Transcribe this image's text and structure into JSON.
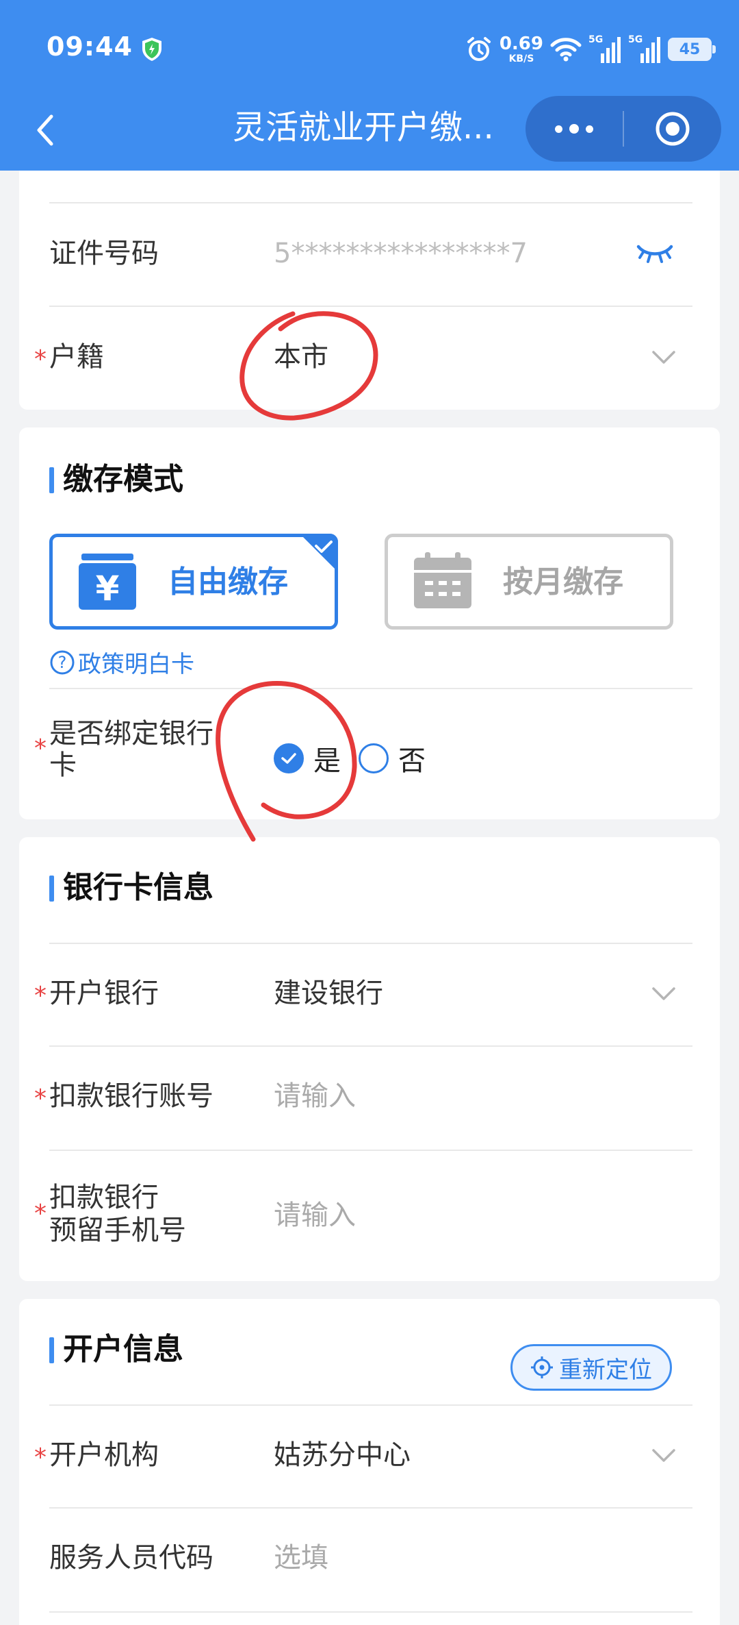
{
  "status_bar": {
    "time": "09:44",
    "net_speed_value": "0.69",
    "net_speed_unit": "KB/S",
    "signal1_tag": "5G",
    "signal2_tag": "5G",
    "battery": "45"
  },
  "nav": {
    "title": "灵活就业开户缴..."
  },
  "identity": {
    "id_label": "证件号码",
    "id_value": "5****************7",
    "household_label": "户籍",
    "household_value": "本市"
  },
  "deposit_mode": {
    "title": "缴存模式",
    "free_label": "自由缴存",
    "monthly_label": "按月缴存",
    "free_icon_glyph": "¥",
    "policy_link": "政策明白卡",
    "bind_label_line1": "是否绑定银行",
    "bind_label_line2": "卡",
    "yes_label": "是",
    "no_label": "否"
  },
  "bank_info": {
    "title": "银行卡信息",
    "bank_label": "开户银行",
    "bank_value": "建设银行",
    "account_label": "扣款银行账号",
    "account_placeholder": "请输入",
    "phone_label_line1": "扣款银行",
    "phone_label_line2": "预留手机号",
    "phone_placeholder": "请输入"
  },
  "account_info": {
    "title": "开户信息",
    "relocate_label": "重新定位",
    "org_label": "开户机构",
    "org_value": "姑苏分中心",
    "staff_label": "服务人员代码",
    "staff_placeholder": "选填"
  },
  "colors": {
    "primary": "#3e8df0",
    "accent": "#2f7fe6",
    "required": "#e84343",
    "annotation": "#e53a3a"
  }
}
